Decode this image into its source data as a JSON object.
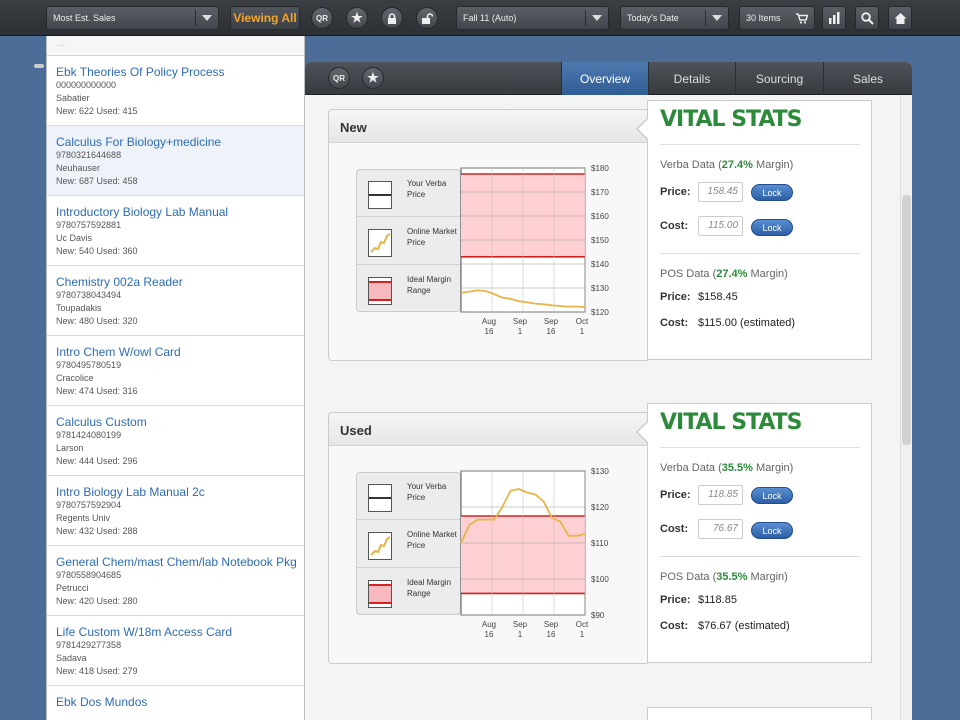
{
  "toolbar": {
    "sort": "Most Est. Sales",
    "viewing": "Viewing All",
    "qr": "QR",
    "term": "Fall 11 (Auto)",
    "date": "Today's Date",
    "items": "30 Items"
  },
  "list": {
    "prev_text": "...",
    "items": [
      {
        "title": "Ebk Theories Of Policy Process",
        "isbn": "000000000000",
        "author": "Sabatier",
        "counts": "New: 622 Used: 415"
      },
      {
        "title": "Calculus For Biology+medicine",
        "isbn": "9780321644688",
        "author": "Neuhauser",
        "counts": "New: 687 Used: 458"
      },
      {
        "title": "Introductory Biology Lab Manual",
        "isbn": "9780757592881",
        "author": "Uc Davis",
        "counts": "New: 540 Used: 360"
      },
      {
        "title": "Chemistry 002a Reader",
        "isbn": "9780738043494",
        "author": "Toupadakis",
        "counts": "New: 480 Used: 320"
      },
      {
        "title": "Intro Chem W/owl Card",
        "isbn": "9780495780519",
        "author": "Cracolice",
        "counts": "New: 474 Used: 316"
      },
      {
        "title": "Calculus Custom",
        "isbn": "9781424080199",
        "author": "Larson",
        "counts": "New: 444 Used: 296"
      },
      {
        "title": "Intro Biology Lab Manual 2c",
        "isbn": "9780757592904",
        "author": "Regents Univ",
        "counts": "New: 432 Used: 288"
      },
      {
        "title": "General Chem/mast Chem/lab Notebook Pkg",
        "isbn": "9780558904685",
        "author": "Petrucci",
        "counts": "New: 420 Used: 280"
      },
      {
        "title": "Life Custom W/18m Access Card",
        "isbn": "9781429277358",
        "author": "Sadava",
        "counts": "New: 418 Used: 279"
      },
      {
        "title": "Ebk Dos Mundos",
        "isbn": "",
        "author": "",
        "counts": ""
      }
    ]
  },
  "panel": {
    "qr": "QR",
    "tabs": [
      "Overview",
      "Details",
      "Sourcing",
      "Sales"
    ]
  },
  "legend": {
    "your_price": "Your Verba Price",
    "online_price": "Online Market Price",
    "ideal_range": "Ideal Margin Range"
  },
  "cards": [
    {
      "title": "New",
      "stats": {
        "heading": "VITAL STATS",
        "verba_prefix": "Verba Data (",
        "verba_margin": "27.4%",
        "verba_suffix": " Margin)",
        "price_label": "Price:",
        "cost_label": "Cost:",
        "price_input": "158.45",
        "cost_input": "115.00",
        "lock": "Lock",
        "pos_prefix": "POS Data (",
        "pos_margin": "27.4%",
        "pos_suffix": " Margin)",
        "pos_price": "$158.45",
        "pos_cost": "$115.00 (estimated)"
      }
    },
    {
      "title": "Used",
      "stats": {
        "heading": "VITAL STATS",
        "verba_prefix": "Verba Data (",
        "verba_margin": "35.5%",
        "verba_suffix": " Margin)",
        "price_label": "Price:",
        "cost_label": "Cost:",
        "price_input": "118.85",
        "cost_input": "76.67",
        "lock": "Lock",
        "pos_prefix": "POS Data (",
        "pos_margin": "35.5%",
        "pos_suffix": " Margin)",
        "pos_price": "$118.85",
        "pos_cost": "$76.67 (estimated)"
      }
    }
  ],
  "colors": {
    "accent_orange": "#f3a52a",
    "link_blue": "#2e6cb5",
    "stats_green": "#2d8a3a",
    "tab_active": "#3d6aa3",
    "range_fill": "#ffd0d3",
    "range_line": "#d32222",
    "market_line": "#e6b54a"
  },
  "chart_data": [
    {
      "type": "line",
      "name": "New",
      "x_ticks": [
        "Aug 16",
        "Sep 1",
        "Sep 16",
        "Oct 1"
      ],
      "y_ticks": [
        "$180",
        "$170",
        "$160",
        "$150",
        "$140",
        "$130",
        "$120"
      ],
      "ylim": [
        120,
        180
      ],
      "your_price": 158.45,
      "ideal_range": [
        143,
        177.5
      ],
      "market_price": [
        128,
        128.5,
        129,
        128.7,
        127.5,
        126,
        125.5,
        124.5,
        124,
        123.5,
        123.2,
        122.8,
        122.5,
        122.2,
        122.3,
        122
      ]
    },
    {
      "type": "line",
      "name": "Used",
      "x_ticks": [
        "Aug 16",
        "Sep 1",
        "Sep 16",
        "Oct 1"
      ],
      "y_ticks": [
        "$130",
        "$120",
        "$110",
        "$100",
        "$90"
      ],
      "ylim": [
        90,
        130
      ],
      "your_price": 118.85,
      "ideal_range": [
        96,
        117.5
      ],
      "market_price": [
        110,
        115,
        116.5,
        116.5,
        116.5,
        120,
        124.5,
        125,
        124,
        123.5,
        121.5,
        117,
        116,
        112,
        112,
        112.5
      ]
    }
  ]
}
